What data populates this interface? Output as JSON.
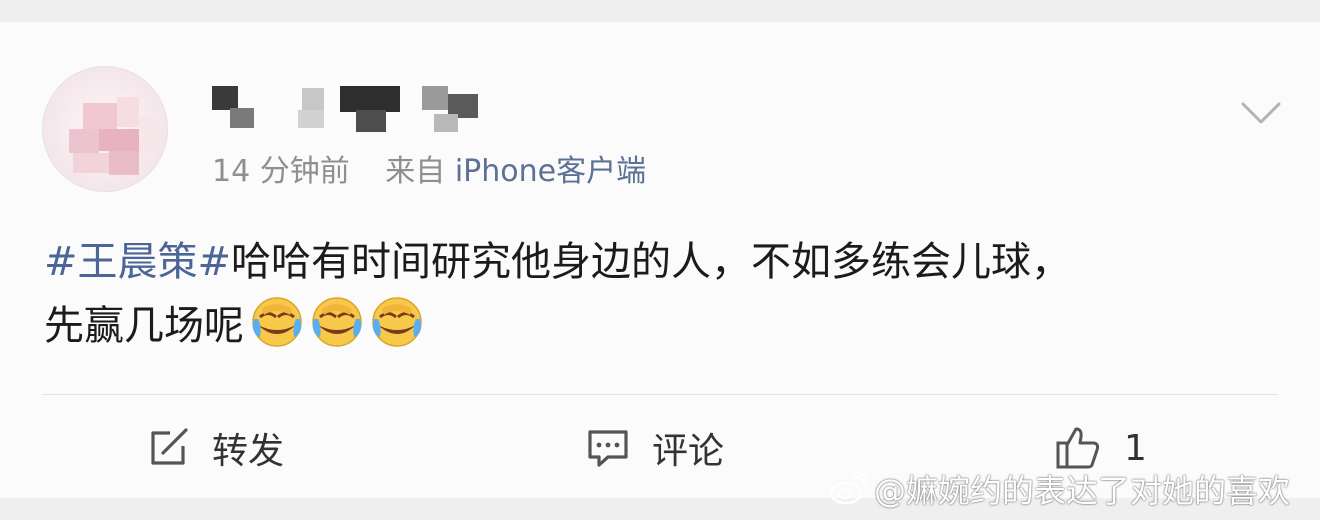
{
  "post": {
    "time": "14 分钟前",
    "source_prefix": "来自",
    "source_client": "iPhone客户端",
    "hashtag": "#王晨策#",
    "body_line1": "哈哈有时间研究他身边的人，不如多练会儿球，",
    "body_line2": "先赢几场呢",
    "emoji": [
      "laughing-crying-emoji",
      "laughing-crying-emoji",
      "laughing-crying-emoji"
    ]
  },
  "actions": {
    "repost_label": "转发",
    "comment_label": "评论",
    "like_count": "1"
  },
  "watermark": {
    "text": "@嫲婉约的表达了对她的喜欢"
  },
  "colors": {
    "link": "#4a6596",
    "client": "#5b7196",
    "meta": "#8f8f8f",
    "text": "#1b1b1b"
  }
}
